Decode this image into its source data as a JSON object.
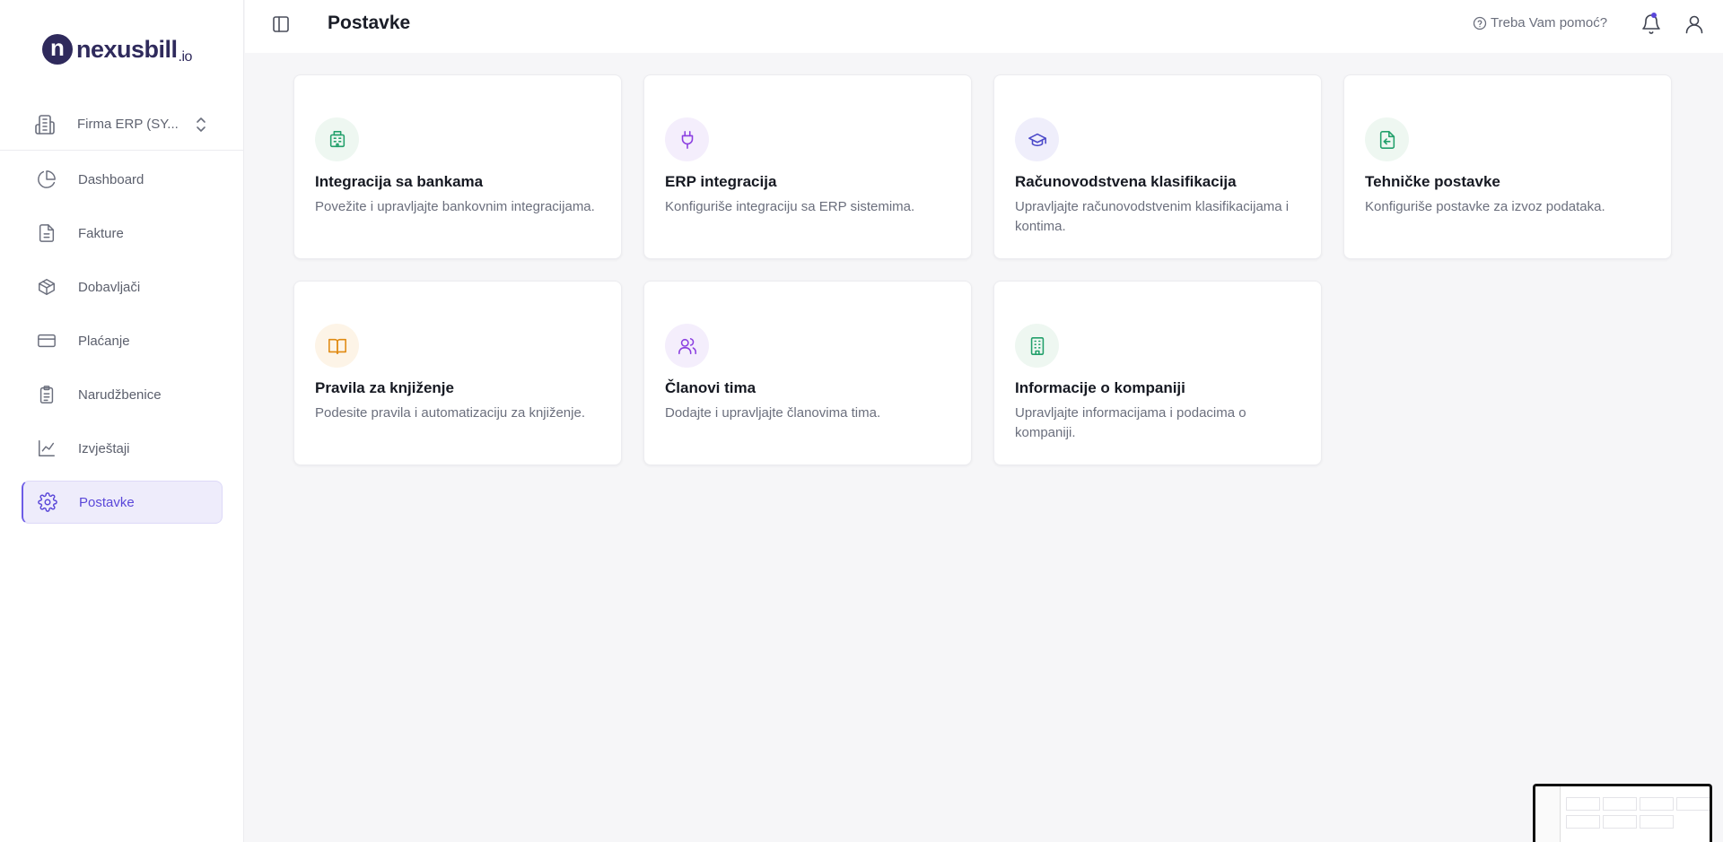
{
  "brand": {
    "mark": "n",
    "name": "nexusbill",
    "tld": ".io"
  },
  "company": {
    "name": "Firma ERP (SY..."
  },
  "sidebar": {
    "items": [
      {
        "label": "Dashboard",
        "icon": "pie-chart-icon"
      },
      {
        "label": "Fakture",
        "icon": "file-icon"
      },
      {
        "label": "Dobavljači",
        "icon": "package-icon"
      },
      {
        "label": "Plaćanje",
        "icon": "credit-card-icon"
      },
      {
        "label": "Narudžbenice",
        "icon": "clipboard-list-icon"
      },
      {
        "label": "Izvještaji",
        "icon": "line-chart-icon"
      },
      {
        "label": "Postavke",
        "icon": "gear-icon",
        "active": true
      }
    ]
  },
  "header": {
    "title": "Postavke",
    "help": "Treba Vam pomoć?"
  },
  "cards": [
    {
      "title": "Integracija sa bankama",
      "desc": "Povežite i upravljajte bankovnim integracijama.",
      "icon": "bank-icon",
      "color": "#22a06b",
      "bg": "#eef7f1"
    },
    {
      "title": "ERP integracija",
      "desc": "Konfiguriše integraciju sa ERP sistemima.",
      "icon": "plug-icon",
      "color": "#8b3fe0",
      "bg": "#f4eefc"
    },
    {
      "title": "Računovodstvena klasifikacija",
      "desc": "Upravljajte računovodstvenim klasifikacijama i kontima.",
      "icon": "graduation-cap-icon",
      "color": "#4b49c9",
      "bg": "#efeefb"
    },
    {
      "title": "Tehničke postavke",
      "desc": "Konfiguriše postavke za izvoz podataka.",
      "icon": "file-export-icon",
      "color": "#22a06b",
      "bg": "#eef7f1"
    },
    {
      "title": "Pravila za knjiženje",
      "desc": "Podesite pravila i automatizaciju za knjiženje.",
      "icon": "open-book-icon",
      "color": "#e08a12",
      "bg": "#fdf4e7"
    },
    {
      "title": "Članovi tima",
      "desc": "Dodajte i upravljajte članovima tima.",
      "icon": "users-icon",
      "color": "#8b3fe0",
      "bg": "#f4eefc"
    },
    {
      "title": "Informacije o kompaniji",
      "desc": "Upravljajte informacijama i podacima o kompaniji.",
      "icon": "building-icon",
      "color": "#22a06b",
      "bg": "#eef7f1"
    }
  ],
  "colors": {
    "accent": "#5a47d9",
    "active_bg": "#eeecfb"
  }
}
